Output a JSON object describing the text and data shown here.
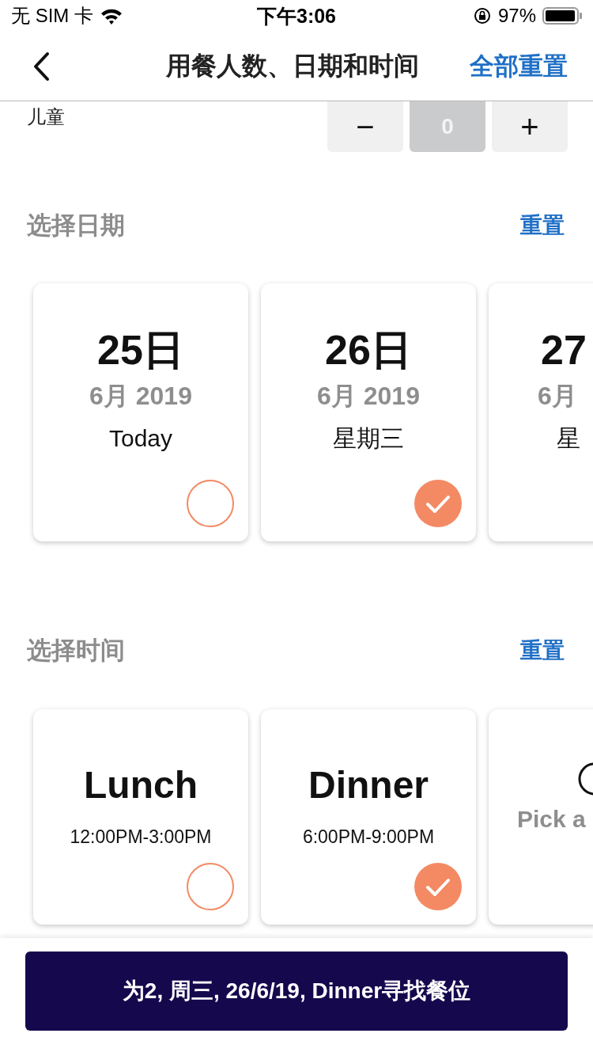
{
  "status_bar": {
    "carrier": "无 SIM 卡",
    "time": "下午3:06",
    "battery": "97%"
  },
  "nav": {
    "title": "用餐人数、日期和时间",
    "action": "全部重置"
  },
  "children_counter": {
    "label": "儿童",
    "minus": "−",
    "value": "0",
    "plus": "+"
  },
  "date_section": {
    "title": "选择日期",
    "reset": "重置",
    "cards": [
      {
        "kind": "full",
        "day": "25日",
        "month": "6月 2019",
        "weekday": "Today",
        "selected": false
      },
      {
        "kind": "full",
        "day": "26日",
        "month": "6月 2019",
        "weekday": "星期三",
        "selected": true
      },
      {
        "kind": "partial",
        "day": "27",
        "month": "6月",
        "weekday": "星"
      }
    ]
  },
  "time_section": {
    "title": "选择时间",
    "reset": "重置",
    "cards": [
      {
        "kind": "meal",
        "name": "Lunch",
        "hours": "12:00PM-3:00PM",
        "selected": false
      },
      {
        "kind": "meal",
        "name": "Dinner",
        "hours": "6:00PM-9:00PM",
        "selected": true
      },
      {
        "kind": "custom",
        "name": "Pick a"
      }
    ]
  },
  "search_button": {
    "label": "为2, 周三, 26/6/19, Dinner寻找餐位"
  }
}
